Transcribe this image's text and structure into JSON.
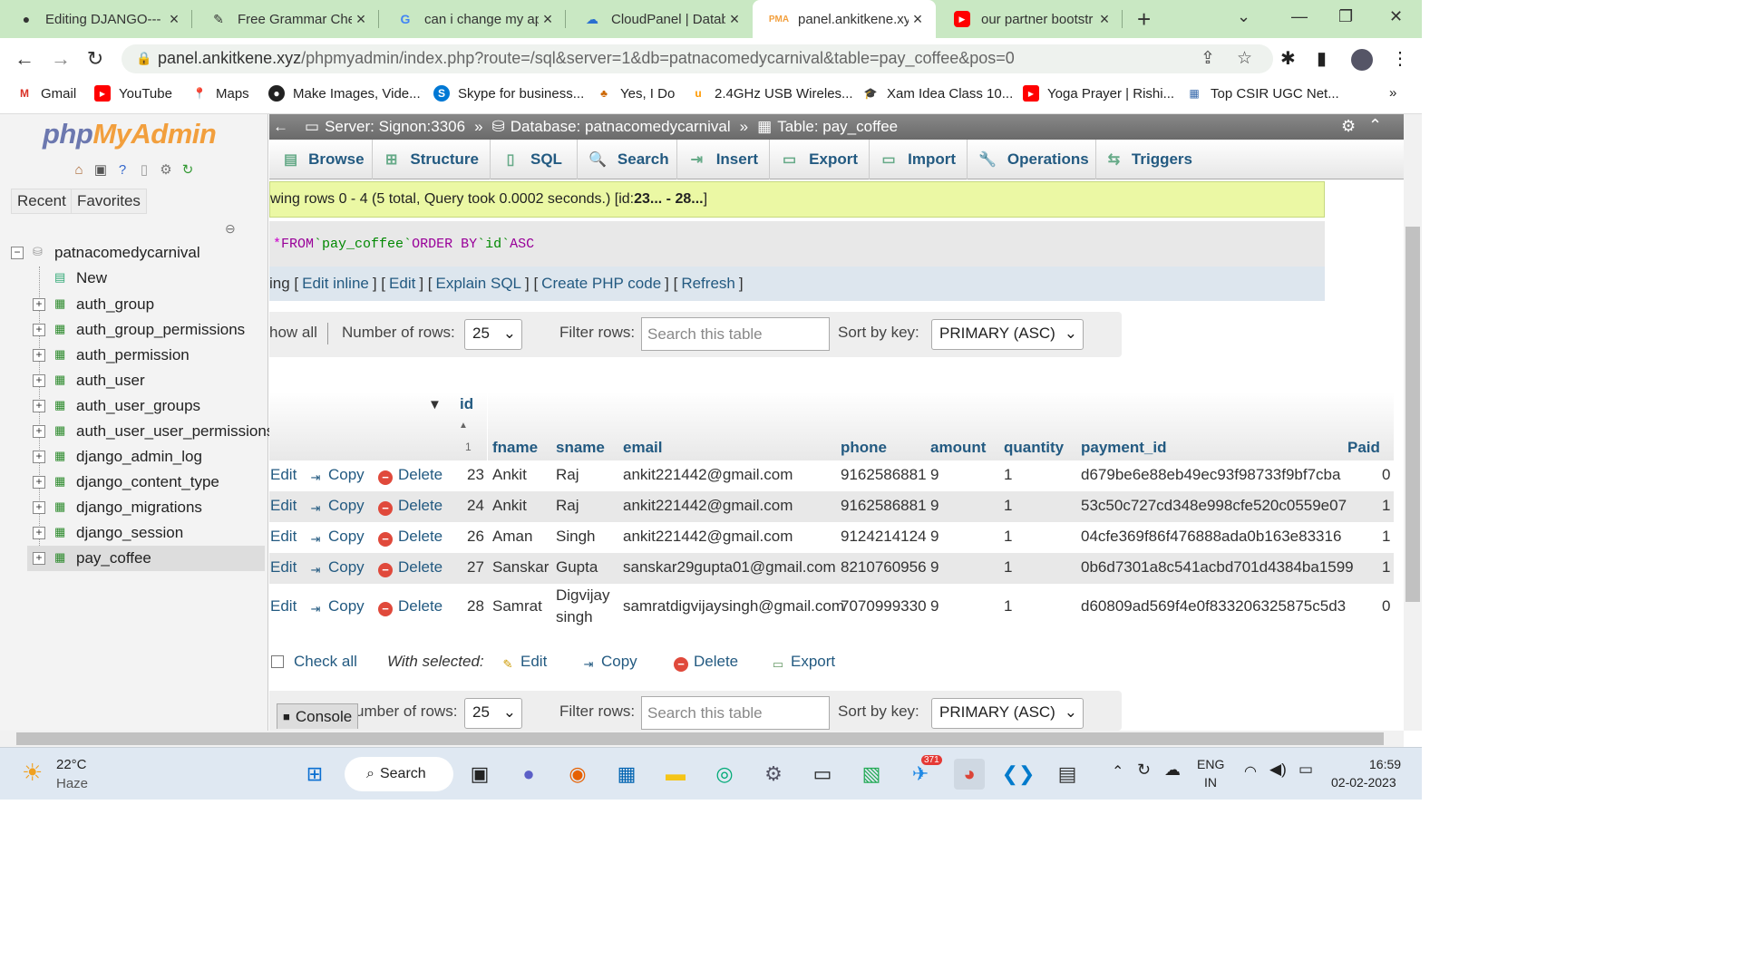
{
  "browser": {
    "tabs": [
      {
        "title": "Editing DJANGO---",
        "icon": "github-icon"
      },
      {
        "title": "Free Grammar Chec",
        "icon": "pen-icon"
      },
      {
        "title": "can i change my ap",
        "icon": "google-icon"
      },
      {
        "title": "CloudPanel | Datab",
        "icon": "cloud-icon"
      },
      {
        "title": "panel.ankitkene.xyz",
        "icon": "phpmyadmin-icon"
      },
      {
        "title": "our partner bootstr",
        "icon": "youtube-icon"
      }
    ],
    "url_host": "panel.ankitkene.xyz",
    "url_path": "/phpmyadmin/index.php?route=/sql&server=1&db=patnacomedycarnival&table=pay_coffee&pos=0",
    "bookmarks": [
      "Gmail",
      "YouTube",
      "Maps",
      "Make Images, Vide...",
      "Skype for business...",
      "Yes, I Do",
      "2.4GHz USB Wireles...",
      "Xam Idea Class 10...",
      "Yoga Prayer | Rishi...",
      "Top CSIR UGC Net..."
    ]
  },
  "sidebar": {
    "logo_php": "php",
    "logo_myadmin": "MyAdmin",
    "recent": "Recent",
    "favorites": "Favorites",
    "db": "patnacomedycarnival",
    "new": "New",
    "tables": [
      "auth_group",
      "auth_group_permissions",
      "auth_permission",
      "auth_user",
      "auth_user_groups",
      "auth_user_user_permissions",
      "django_admin_log",
      "django_content_type",
      "django_migrations",
      "django_session",
      "pay_coffee"
    ]
  },
  "breadcrumb": {
    "server": "Server: Signon:3306",
    "database": "Database: patnacomedycarnival",
    "table": "Table: pay_coffee"
  },
  "tabs": [
    "Browse",
    "Structure",
    "SQL",
    "Search",
    "Insert",
    "Export",
    "Import",
    "Operations",
    "Triggers"
  ],
  "success": {
    "text": "wing rows 0 - 4 (5 total, Query took 0.0002 seconds.) [id: ",
    "range": "23... - 28...",
    "end": "]"
  },
  "sql": {
    "star": "*",
    "from": "FROM",
    "table": "`pay_coffee`",
    "order": "ORDER BY",
    "col": "`id`",
    "dir": "ASC"
  },
  "sql_links": {
    "prefix": "ing [",
    "edit_inline": "Edit inline",
    "edit": "Edit",
    "explain": "Explain SQL",
    "create_php": "Create PHP code",
    "refresh": "Refresh"
  },
  "nav": {
    "show_all": "how all",
    "num_rows_label": "Number of rows:",
    "num_rows_label_bottom": "umber of rows:",
    "num_rows": "25",
    "filter_label": "Filter rows:",
    "filter_placeholder": "Search this table",
    "sort_label": "Sort by key:",
    "sort_value": "PRIMARY (ASC)"
  },
  "table": {
    "sort_arrow": "▲",
    "sort_num": "1",
    "columns": [
      "id",
      "fname",
      "sname",
      "email",
      "phone",
      "amount",
      "quantity",
      "payment_id",
      "Paid"
    ],
    "actions": {
      "edit": "Edit",
      "copy": "Copy",
      "delete": "Delete"
    },
    "rows": [
      {
        "id": "23",
        "fname": "Ankit",
        "sname": "Raj",
        "email": "ankit221442@gmail.com",
        "phone": "9162586881",
        "amount": "9",
        "quantity": "1",
        "payment_id": "d679be6e88eb49ec93f98733f9bf7cba",
        "paid": "0"
      },
      {
        "id": "24",
        "fname": "Ankit",
        "sname": "Raj",
        "email": "ankit221442@gmail.com",
        "phone": "9162586881",
        "amount": "9",
        "quantity": "1",
        "payment_id": "53c50c727cd348e998cfe520c0559e07",
        "paid": "1"
      },
      {
        "id": "26",
        "fname": "Aman",
        "sname": "Singh",
        "email": "ankit221442@gmail.com",
        "phone": "9124214124",
        "amount": "9",
        "quantity": "1",
        "payment_id": "04cfe369f86f476888ada0b163e83316",
        "paid": "1"
      },
      {
        "id": "27",
        "fname": "Sanskar",
        "sname": "Gupta",
        "email": "sanskar29gupta01@gmail.com",
        "phone": "8210760956",
        "amount": "9",
        "quantity": "1",
        "payment_id": "0b6d7301a8c541acbd701d4384ba1599",
        "paid": "1"
      },
      {
        "id": "28",
        "fname": "Samrat",
        "sname": "Digvijay singh",
        "sname1": "Digvijay",
        "sname2": "singh",
        "email": "samratdigvijaysingh@gmail.com",
        "phone": "7070999330",
        "amount": "9",
        "quantity": "1",
        "payment_id": "d60809ad569f4e0f833206325875c5d3",
        "paid": "0"
      }
    ]
  },
  "bulk": {
    "check_all": "Check all",
    "with_selected": "With selected:",
    "edit": "Edit",
    "copy": "Copy",
    "delete": "Delete",
    "export": "Export"
  },
  "console": "Console",
  "taskbar": {
    "temp": "22°C",
    "weather": "Haze",
    "search": "Search",
    "badge": "371",
    "lang1": "ENG",
    "lang2": "IN",
    "time": "16:59",
    "date": "02-02-2023"
  },
  "colors": {
    "tabstrip": "#c9e8c3",
    "link": "#235a81",
    "success": "#ebf8a4"
  }
}
